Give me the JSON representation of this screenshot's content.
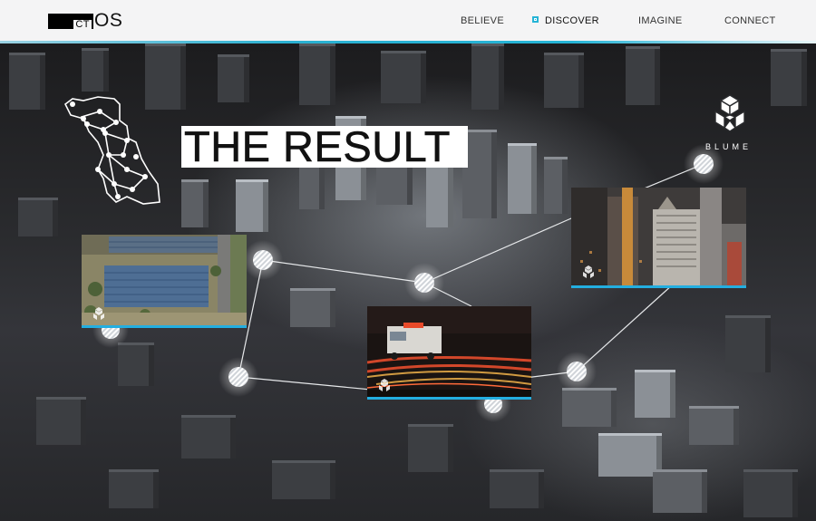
{
  "header": {
    "logo": {
      "ct": "CT",
      "os": "OS"
    },
    "nav": [
      {
        "label": "BELIEVE",
        "active": false
      },
      {
        "label": "DISCOVER",
        "active": true
      },
      {
        "label": "IMAGINE",
        "active": false
      },
      {
        "label": "CONNECT",
        "active": false
      }
    ]
  },
  "main": {
    "title": "THE RESULT",
    "brand": "BLUME",
    "cards": [
      {
        "name": "solar-farm",
        "icon": "hexagon-icon"
      },
      {
        "name": "ambulance",
        "icon": "hexagon-icon"
      },
      {
        "name": "city-skyline",
        "icon": "hexagon-icon"
      }
    ]
  },
  "colors": {
    "accent": "#25b4d6",
    "header_bg": "#f4f4f5",
    "title_bg": "#ffffff"
  }
}
